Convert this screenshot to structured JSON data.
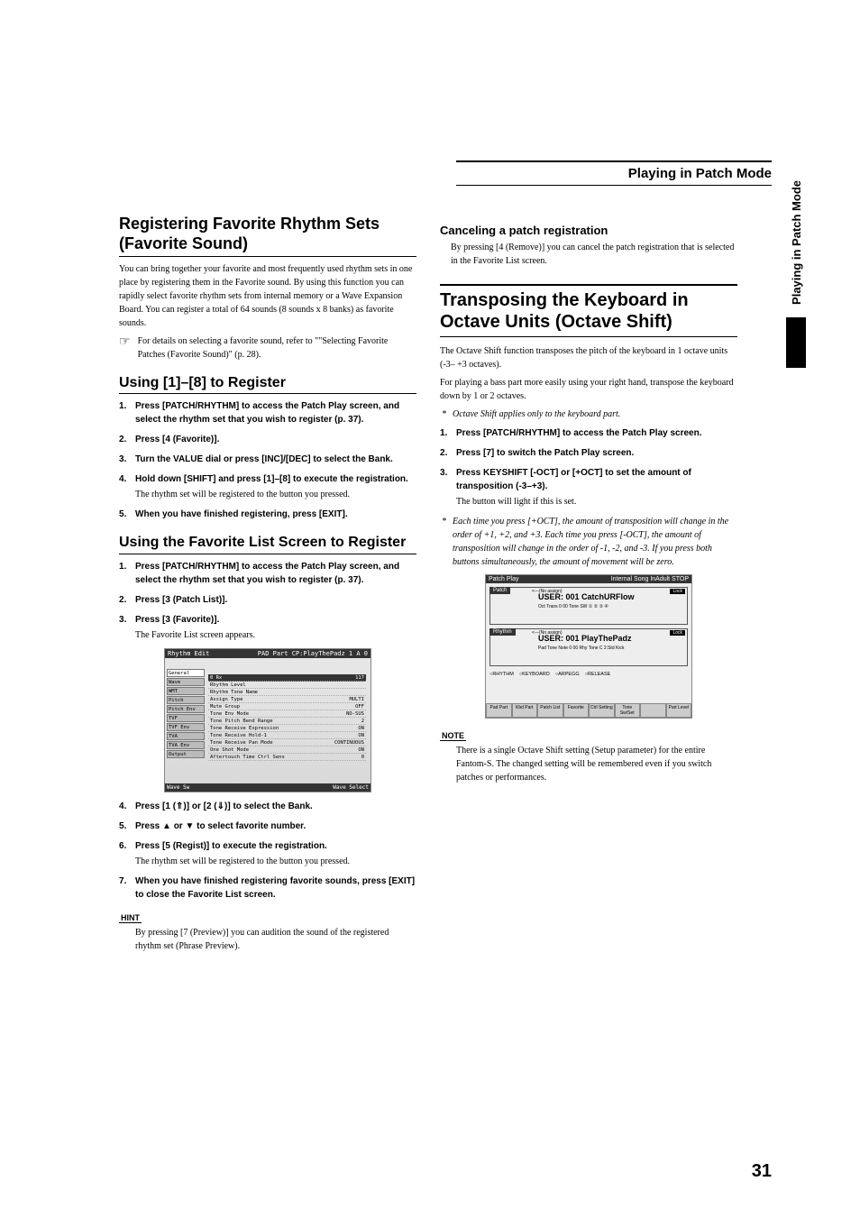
{
  "header": {
    "title": "Playing in Patch Mode"
  },
  "sidetab": {
    "label": "Playing in Patch Mode"
  },
  "left": {
    "h1": "Registering Favorite Rhythm Sets (Favorite Sound)",
    "intro": "You can bring together your favorite and most frequently used rhythm sets in one place by registering them in the Favorite sound. By using this function you can rapidly select favorite rhythm sets from internal memory or a Wave Expansion Board. You can register a total of 64 sounds (8 sounds x 8 banks) as favorite sounds.",
    "ref_icon": "☞",
    "ref": "For details on selecting a favorite sound, refer to \"\"Selecting Favorite Patches (Favorite Sound)\" (p. 28).",
    "h2a": "Using [1]–[8] to Register",
    "stepsA": [
      {
        "t": "Press [PATCH/RHYTHM] to access the Patch Play screen, and select the rhythm set that you wish to register (p. 37)."
      },
      {
        "t": "Press [4 (Favorite)]."
      },
      {
        "t": "Turn the VALUE dial or press [INC]/[DEC] to select the Bank."
      },
      {
        "t": "Hold down [SHIFT] and press [1]–[8] to execute the registration.",
        "s": "The rhythm set will be registered to the button you pressed."
      },
      {
        "t": "When you have finished registering, press [EXIT]."
      }
    ],
    "h2b": "Using the Favorite List Screen to Register",
    "stepsB": [
      {
        "t": "Press [PATCH/RHYTHM] to access the Patch Play screen, and select the rhythm set that you wish to register (p. 37)."
      },
      {
        "t": "Press [3 (Patch List)]."
      },
      {
        "t": "Press [3 (Favorite)].",
        "s": "The Favorite List screen appears."
      }
    ],
    "screenshot1": {
      "title_l": "Rhythm Edit",
      "title_r": "PAD Part  CP:PlayThePadz 1 A 0",
      "cats": [
        "General",
        "Wave",
        "WMT",
        "Pitch",
        "Pitch Env",
        "TVF",
        "TVF Env",
        "TVA",
        "TVA Env",
        "Output"
      ],
      "active_cat": 0,
      "rows": [
        {
          "l": "0 Rx",
          "r": "117",
          "hl": true
        },
        {
          "l": "Rhythm Level",
          "r": ""
        },
        {
          "l": "Rhythm Tone Name",
          "r": ""
        },
        {
          "l": "Assign Type",
          "r": "MULTI"
        },
        {
          "l": "Mute Group",
          "r": "OFF"
        },
        {
          "l": "Tone Env Mode",
          "r": "NO-SUS"
        },
        {
          "l": "Tone Pitch Bend Range",
          "r": "2"
        },
        {
          "l": "Tone Receive Expression",
          "r": "ON"
        },
        {
          "l": "Tone Receive Hold-1",
          "r": "ON"
        },
        {
          "l": "Tone Receive Pan Mode",
          "r": "CONTINUOUS"
        },
        {
          "l": "One Shot Mode",
          "r": "ON"
        },
        {
          "l": "Aftertouch Time Ctrl Sens",
          "r": "0"
        }
      ],
      "foot_l": "Wave Sw",
      "foot_r": "Wave Select"
    },
    "stepsC": [
      {
        "t": "Press [1 (⇑)] or [2 (⇓)] to select the Bank."
      },
      {
        "t": "Press ▲ or ▼ to select favorite number."
      },
      {
        "t": "Press [5 (Regist)] to execute the registration.",
        "s": "The rhythm set will be registered to the button you pressed."
      },
      {
        "t": "When you have finished registering favorite sounds, press [EXIT] to close the Favorite List screen."
      }
    ],
    "hint_label": "HINT",
    "hint": "By pressing [7 (Preview)] you can audition the sound of the registered rhythm set (Phrase Preview)."
  },
  "right": {
    "h3a": "Canceling a patch registration",
    "cancel": "By pressing [4 (Remove)] you can cancel the patch registration that is selected in the Favorite List screen.",
    "h2major": "Transposing the Keyboard in Octave Units (Octave Shift)",
    "p1": "The Octave Shift function transposes the pitch of the keyboard in 1 octave units (-3– +3 octaves).",
    "p2": "For playing a bass part more easily using your right hand, transpose the keyboard down by 1 or 2 octaves.",
    "note1": "Octave Shift applies only to the keyboard part.",
    "steps": [
      {
        "t": "Press [PATCH/RHYTHM] to access the Patch Play screen."
      },
      {
        "t": "Press [7] to switch the Patch Play screen."
      },
      {
        "t": "Press KEYSHIFT [-OCT] or [+OCT] to set the amount of transposition (-3–+3).",
        "s": "The button will light if this is set."
      }
    ],
    "note2": "Each time you press [+OCT], the amount of transposition will change in the order of +1, +2, and +3. Each time you press [-OCT], the amount of transposition will change in the order of -1, -2, and -3. If you press both buttons simultaneously, the amount of movement will be zero.",
    "screenshot2": {
      "title_l": "Patch Play",
      "title_r": "Internal Song InAdult STOP",
      "patch": {
        "label": "Patch",
        "assign": "<---(No assign)",
        "lock": "Lock",
        "name": "USER: 001 CatchURFlow",
        "sub": "Oct  Trans  0 00  Tone SW ① ② ③ ④"
      },
      "rhythm": {
        "label": "Rhythm",
        "assign": "<---(No assign)",
        "lock": "Lock",
        "name": "USER: 001 PlayThePadz",
        "sub": "Pad Tone  Note  0 00  Rhy Tone C 2:Std Kick"
      },
      "btns": [
        "○RHYTHM",
        "○KEYBOARD",
        "○ARPEGG",
        "○RELEASE"
      ],
      "foot": [
        "Pad Part",
        "Kbd Part",
        "Patch List",
        "Favorite",
        "Ctrl Setting",
        "Tone Sw/Set",
        "",
        "Part Level"
      ]
    },
    "note_label": "NOTE",
    "note_text": "There is a single Octave Shift setting (Setup parameter) for the entire Fantom-S. The changed setting will be remembered even if you switch patches or performances."
  },
  "page_number": "31"
}
